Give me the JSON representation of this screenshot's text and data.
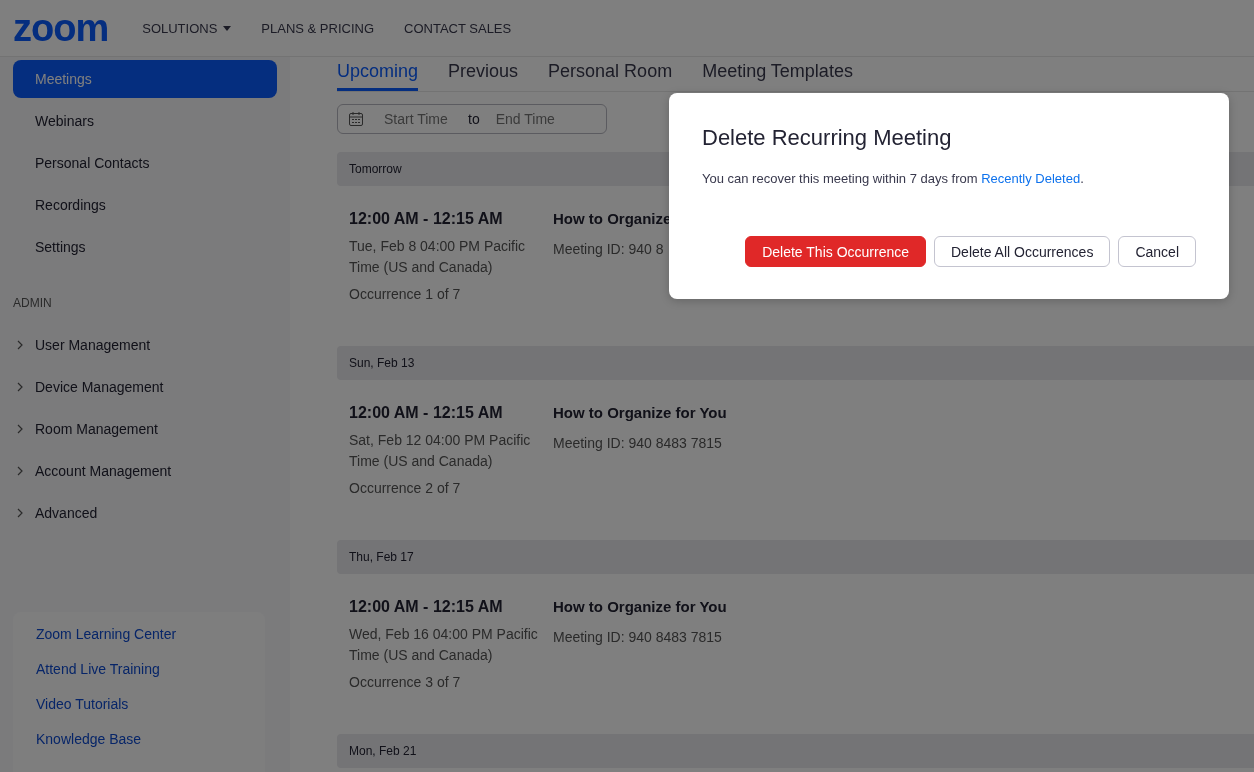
{
  "header": {
    "logo": "zoom",
    "nav": [
      {
        "label": "SOLUTIONS",
        "dropdown": true
      },
      {
        "label": "PLANS & PRICING",
        "dropdown": false
      },
      {
        "label": "CONTACT SALES",
        "dropdown": false
      }
    ]
  },
  "sidebar": {
    "items": [
      {
        "label": "Meetings",
        "selected": true
      },
      {
        "label": "Webinars",
        "selected": false
      },
      {
        "label": "Personal Contacts",
        "selected": false
      },
      {
        "label": "Recordings",
        "selected": false
      },
      {
        "label": "Settings",
        "selected": false
      }
    ],
    "admin_heading": "ADMIN",
    "admin_items": [
      {
        "label": "User Management",
        "expanded": false
      },
      {
        "label": "Device Management",
        "expanded": false
      },
      {
        "label": "Room Management",
        "expanded": false
      },
      {
        "label": "Account Management",
        "expanded": false
      },
      {
        "label": "Advanced",
        "expanded": false
      }
    ],
    "resources": [
      "Zoom Learning Center",
      "Attend Live Training",
      "Video Tutorials",
      "Knowledge Base"
    ]
  },
  "main": {
    "tabs": [
      {
        "label": "Upcoming",
        "selected": true
      },
      {
        "label": "Previous",
        "selected": false
      },
      {
        "label": "Personal Room",
        "selected": false
      },
      {
        "label": "Meeting Templates",
        "selected": false
      }
    ],
    "date_range": {
      "start_placeholder": "Start Time",
      "separator": "to",
      "end_placeholder": "End Time"
    },
    "groups": [
      {
        "date": "Tomorrow",
        "meetings": [
          {
            "time": "12:00 AM - 12:15 AM",
            "datetime": "Tue, Feb 8 04:00 PM Pacific Time (US and Canada)",
            "occurrence": "Occurrence 1 of 7",
            "topic": "How to Organize",
            "meeting_id": "Meeting ID: 940 8"
          }
        ]
      },
      {
        "date": "Sun, Feb 13",
        "meetings": [
          {
            "time": "12:00 AM - 12:15 AM",
            "datetime": "Sat, Feb 12 04:00 PM Pacific Time (US and Canada)",
            "occurrence": "Occurrence 2 of 7",
            "topic": "How to Organize for You",
            "meeting_id": "Meeting ID: 940 8483 7815"
          }
        ]
      },
      {
        "date": "Thu, Feb 17",
        "meetings": [
          {
            "time": "12:00 AM - 12:15 AM",
            "datetime": "Wed, Feb 16 04:00 PM Pacific Time (US and Canada)",
            "occurrence": "Occurrence 3 of 7",
            "topic": "How to Organize for You",
            "meeting_id": "Meeting ID: 940 8483 7815"
          }
        ]
      },
      {
        "date": "Mon, Feb 21"
      }
    ]
  },
  "dialog": {
    "title": "Delete Recurring Meeting",
    "message": "You can recover this meeting within 7 days from ",
    "link": "Recently Deleted",
    "message_end": ".",
    "buttons": [
      {
        "label": "Delete This Occurrence",
        "kind": "danger"
      },
      {
        "label": "Delete All Occurrences",
        "kind": "secondary"
      },
      {
        "label": "Cancel",
        "kind": "secondary"
      }
    ]
  }
}
